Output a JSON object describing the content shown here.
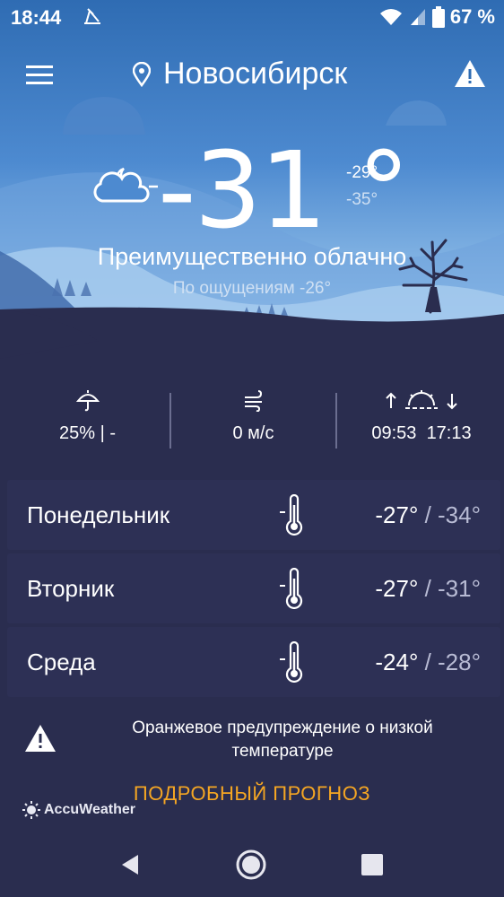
{
  "status_bar": {
    "time": "18:44",
    "battery_percent": "67 %",
    "icons": [
      "notification-icon",
      "wifi-icon",
      "signal-icon",
      "battery-icon"
    ]
  },
  "header": {
    "city": "Новосибирск",
    "icons": [
      "menu-icon",
      "location-pin-icon",
      "alert-icon"
    ]
  },
  "current": {
    "temperature": "-31 °",
    "high": "-29°",
    "low": "-35°",
    "condition": "Преимущественно облачно",
    "feels_like": "По ощущениям -26°",
    "icon": "partly-cloudy-night-icon"
  },
  "stats": {
    "precipitation": "25% | -",
    "wind": "0 м/с",
    "sunrise": "09:53",
    "sunset": "17:13",
    "icons": [
      "umbrella-icon",
      "wind-icon",
      "sunrise-sunset-icon"
    ]
  },
  "forecast": [
    {
      "day": "Понедельник",
      "high": "-27°",
      "sep": " / ",
      "low": "-34°"
    },
    {
      "day": "Вторник",
      "high": "-27°",
      "sep": " / ",
      "low": "-31°"
    },
    {
      "day": "Среда",
      "high": "-24°",
      "sep": " / ",
      "low": "-28°"
    }
  ],
  "warning": {
    "text_line1": "Оранжевое предупреждение о низкой",
    "text_line2": "температуре"
  },
  "detail_link": "ПОДРОБНЫЙ ПРОГНОЗ",
  "brand": "AccuWeather",
  "colors": {
    "sky_top": "#2f6cb3",
    "ground": "#2a2d4f",
    "link_orange": "#f5a623"
  }
}
